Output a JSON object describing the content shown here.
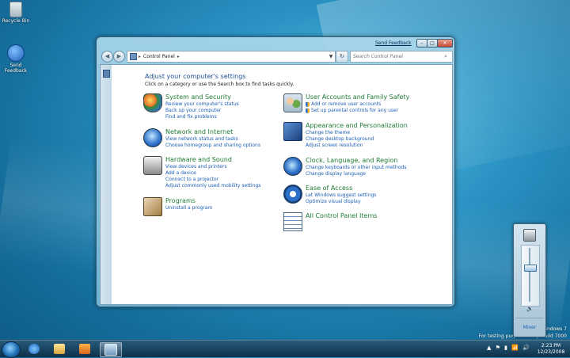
{
  "desktop": {
    "icons": [
      {
        "label": "Recycle Bin",
        "icon": "recycle-bin-icon"
      },
      {
        "label": "Send Feedback",
        "icon": "send-feedback-icon"
      }
    ],
    "watermark": {
      "line1": "Windows 7",
      "line2": "For testing purposes only. Build 7000"
    }
  },
  "window": {
    "feedback_link": "Send Feedback",
    "controls": {
      "minimize": "–",
      "maximize": "□",
      "close": "✕"
    },
    "toolbar": {
      "back": "◀",
      "forward": "▶",
      "address": "Control Panel",
      "refresh": "↻",
      "search_placeholder": "Search Control Panel"
    },
    "heading": "Adjust your computer's settings",
    "subheading": "Click on a category or use the Search box to find tasks quickly.",
    "categories_left": [
      {
        "title": "System and Security",
        "icon": "system-security-icon",
        "links": [
          "Review your computer's status",
          "Back up your computer",
          "Find and fix problems"
        ]
      },
      {
        "title": "Network and Internet",
        "icon": "network-internet-icon",
        "links": [
          "View network status and tasks",
          "Choose homegroup and sharing options"
        ]
      },
      {
        "title": "Hardware and Sound",
        "icon": "hardware-sound-icon",
        "links": [
          "View devices and printers",
          "Add a device",
          "Connect to a projector",
          "Adjust commonly used mobility settings"
        ]
      },
      {
        "title": "Programs",
        "icon": "programs-icon",
        "links": [
          "Uninstall a program"
        ]
      }
    ],
    "categories_right": [
      {
        "title": "User Accounts and Family Safety",
        "icon": "user-accounts-icon",
        "links": [
          "Add or remove user accounts",
          "Set up parental controls for any user"
        ]
      },
      {
        "title": "Appearance and Personalization",
        "icon": "appearance-icon",
        "links": [
          "Change the theme",
          "Change desktop background",
          "Adjust screen resolution"
        ]
      },
      {
        "title": "Clock, Language, and Region",
        "icon": "clock-language-icon",
        "links": [
          "Change keyboards or other input methods",
          "Change display language"
        ]
      },
      {
        "title": "Ease of Access",
        "icon": "ease-of-access-icon",
        "links": [
          "Let Windows suggest settings",
          "Optimize visual display"
        ]
      },
      {
        "title": "All Control Panel Items",
        "icon": "all-items-icon",
        "links": []
      }
    ]
  },
  "volume_mixer": {
    "level": 0.65,
    "speaker_glyph": "🔈",
    "mixer_label": "Mixer"
  },
  "taskbar": {
    "items": [
      "internet-explorer",
      "windows-explorer",
      "media-player",
      "control-panel"
    ],
    "active_item": "control-panel",
    "tray_glyphs": [
      "▲",
      "⚑",
      "▮",
      "📶",
      "🔊"
    ],
    "time": "2:23 PM",
    "date": "12/23/2008"
  }
}
